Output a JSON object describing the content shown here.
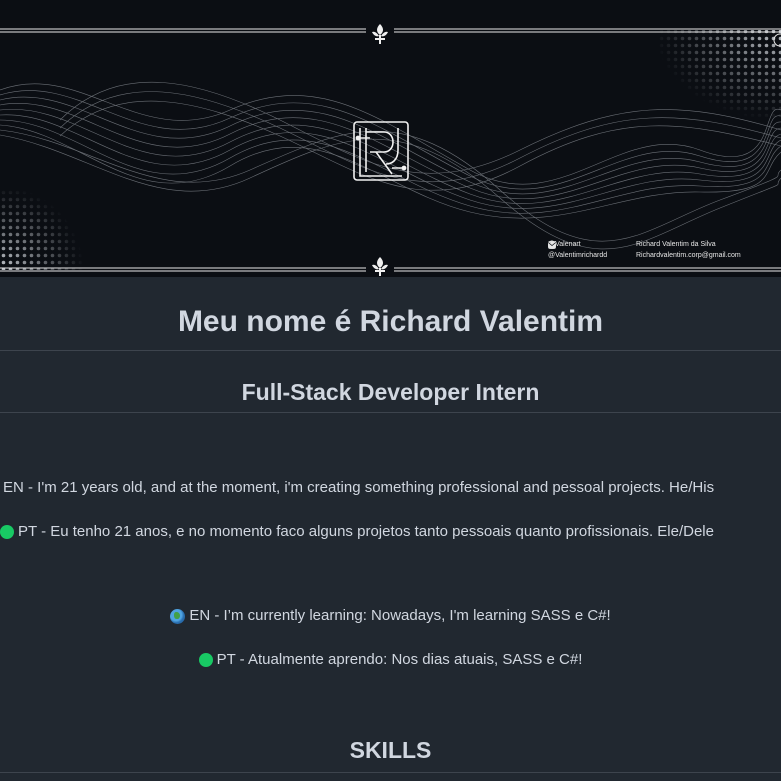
{
  "banner": {
    "contacts": [
      {
        "icon": "github-icon",
        "text": "@Valenart"
      },
      {
        "icon": "linkedin-icon",
        "text": "Richard Valentim da Silva"
      },
      {
        "icon": "instagram-icon",
        "text": "@Valentimrichardd"
      },
      {
        "icon": "mail-icon",
        "text": "Richardvalentim.corp@gmail.com"
      }
    ]
  },
  "heading": "Meu nome é Richard Valentim",
  "subheading": "Full-Stack Developer Intern",
  "about": {
    "en": "EN - I'm 21 years old, and at the moment, i'm creating something professional and pessoal projects. He/His",
    "pt": "PT - Eu tenho 21 anos, e no momento faco alguns projetos tanto pessoais quanto profissionais. Ele/Dele"
  },
  "learning": {
    "en": "EN - I’m currently learning: Nowadays, I'm learning SASS e C#!",
    "pt": "PT - Atualmente aprendo: Nos dias atuais, SASS e C#!"
  },
  "skills_heading": "SKILLS",
  "colors": {
    "background": "#212830",
    "banner": "#0b0e13",
    "text": "#d1d7e0",
    "green_dot": "#18c964"
  }
}
